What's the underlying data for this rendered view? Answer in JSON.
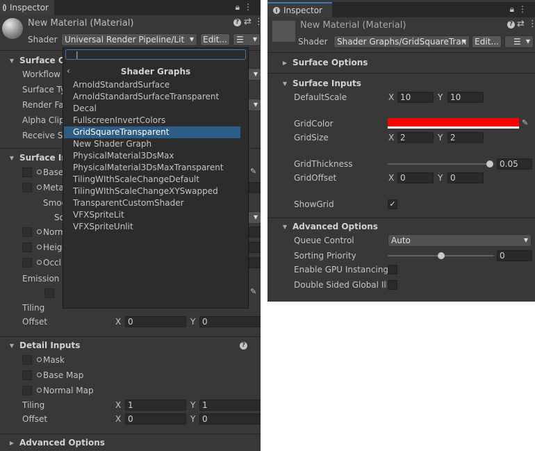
{
  "left": {
    "tab_title": "Inspector",
    "material_name": "New Material (Material)",
    "shader_label": "Shader",
    "shader_value": "Universal Render Pipeline/Lit",
    "edit_label": "Edit...",
    "surface_options_header": "Surface Op",
    "surface_options_rows": [
      "Workflow",
      "Surface Ty",
      "Render Fa",
      "Alpha Clip",
      "Receive S"
    ],
    "surface_inputs_header": "Surface Inp",
    "surface_inputs_rows": [
      "Base",
      "Meta",
      "Smoo",
      "So",
      "Norm",
      "Heig",
      "Occl"
    ],
    "emission_label": "Emission",
    "tiling_label": "Tiling",
    "offset_label": "Offset",
    "offset_x": "0",
    "offset_y": "0",
    "axis_x": "X",
    "axis_y": "Y",
    "detail_inputs_header": "Detail Inputs",
    "detail_rows": [
      "Mask",
      "Base Map",
      "Normal Map"
    ],
    "detail_tiling_x": "1",
    "detail_tiling_y": "1",
    "detail_offset_x": "0",
    "detail_offset_y": "0",
    "advanced_options_header": "Advanced Options"
  },
  "popup": {
    "title": "Shader Graphs",
    "search_value": "",
    "items": [
      "ArnoldStandardSurface",
      "ArnoldStandardSurfaceTransparent",
      "Decal",
      "FullscreenInvertColors",
      "GridSquareTransparent",
      "New Shader Graph",
      "PhysicalMaterial3DsMax",
      "PhysicalMaterial3DsMaxTransparent",
      "TilingWIthScaleChangeDefault",
      "TilingWIthScaleChangeXYSwapped",
      "TransparentCustomShader",
      "VFXSpriteLit",
      "VFXSpriteUnlit"
    ],
    "selected": "GridSquareTransparent"
  },
  "right": {
    "tab_title": "Inspector",
    "material_name": "New Material (Material)",
    "shader_label": "Shader",
    "shader_value": "Shader Graphs/GridSquareTran",
    "edit_label": "Edit...",
    "surface_options_header": "Surface Options",
    "surface_inputs_header": "Surface Inputs",
    "default_scale_label": "DefaultScale",
    "default_scale_x": "10",
    "default_scale_y": "10",
    "grid_color_label": "GridColor",
    "grid_color": "#ff0000",
    "grid_size_label": "GridSize",
    "grid_size_x": "2",
    "grid_size_y": "2",
    "grid_thickness_label": "GridThickness",
    "grid_thickness_value": "0.05",
    "grid_thickness_fraction": 0.98,
    "grid_offset_label": "GridOffset",
    "grid_offset_x": "0",
    "grid_offset_y": "0",
    "show_grid_label": "ShowGrid",
    "show_grid_checked": true,
    "advanced_options_header": "Advanced Options",
    "queue_control_label": "Queue Control",
    "queue_control_value": "Auto",
    "sorting_priority_label": "Sorting Priority",
    "sorting_priority_value": "0",
    "sorting_priority_fraction": 0.5,
    "gpu_instancing_label": "Enable GPU Instancing",
    "double_sided_label": "Double Sided Global Illu",
    "axis_x": "X",
    "axis_y": "Y"
  },
  "colors": {
    "panel_bg": "#383838",
    "selection": "#2c5d87",
    "grid_color": "#ff0000"
  },
  "icons": [
    "info-icon",
    "lock-icon",
    "menu-dots-icon",
    "help-icon",
    "preset-icon",
    "list-icon",
    "eyedropper-icon",
    "chevron-left-icon",
    "foldout-arrow-icon"
  ]
}
